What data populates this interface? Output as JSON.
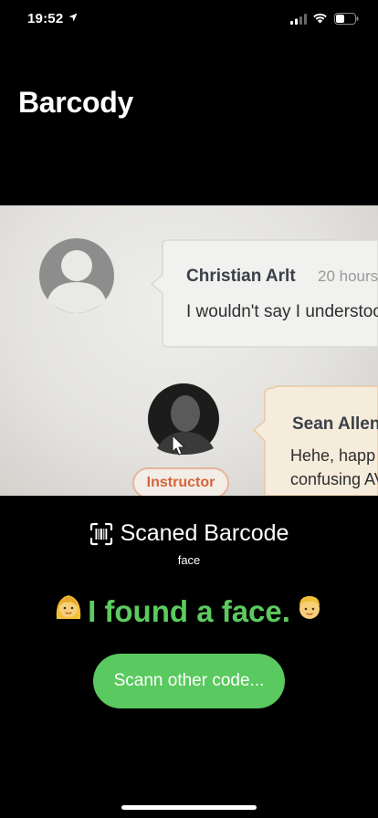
{
  "status_bar": {
    "time": "19:52",
    "icons": [
      "location-arrow-icon",
      "cellular-signal-icon",
      "wifi-icon",
      "battery-icon"
    ]
  },
  "app": {
    "title": "Barcody"
  },
  "camera_image": {
    "comment_1": {
      "author": "Christian Arlt",
      "time": "20 hours",
      "text": "I wouldn't say I understoo"
    },
    "comment_2": {
      "author": "Sean Allen",
      "text_line_1": "Hehe, happ",
      "text_line_2": "confusing AV",
      "badge": "Instructor"
    }
  },
  "scan": {
    "icon": "barcode-viewfinder-icon",
    "label": "Scaned Barcode",
    "type": "face"
  },
  "result": {
    "text": "I found a face.",
    "leading_emoji": "👱‍♀️",
    "trailing_emoji": "👱‍♂️",
    "color": "#5ccb5f"
  },
  "actions": {
    "rescan_label": "Scann other code...",
    "rescan_color": "#5ac95f"
  }
}
